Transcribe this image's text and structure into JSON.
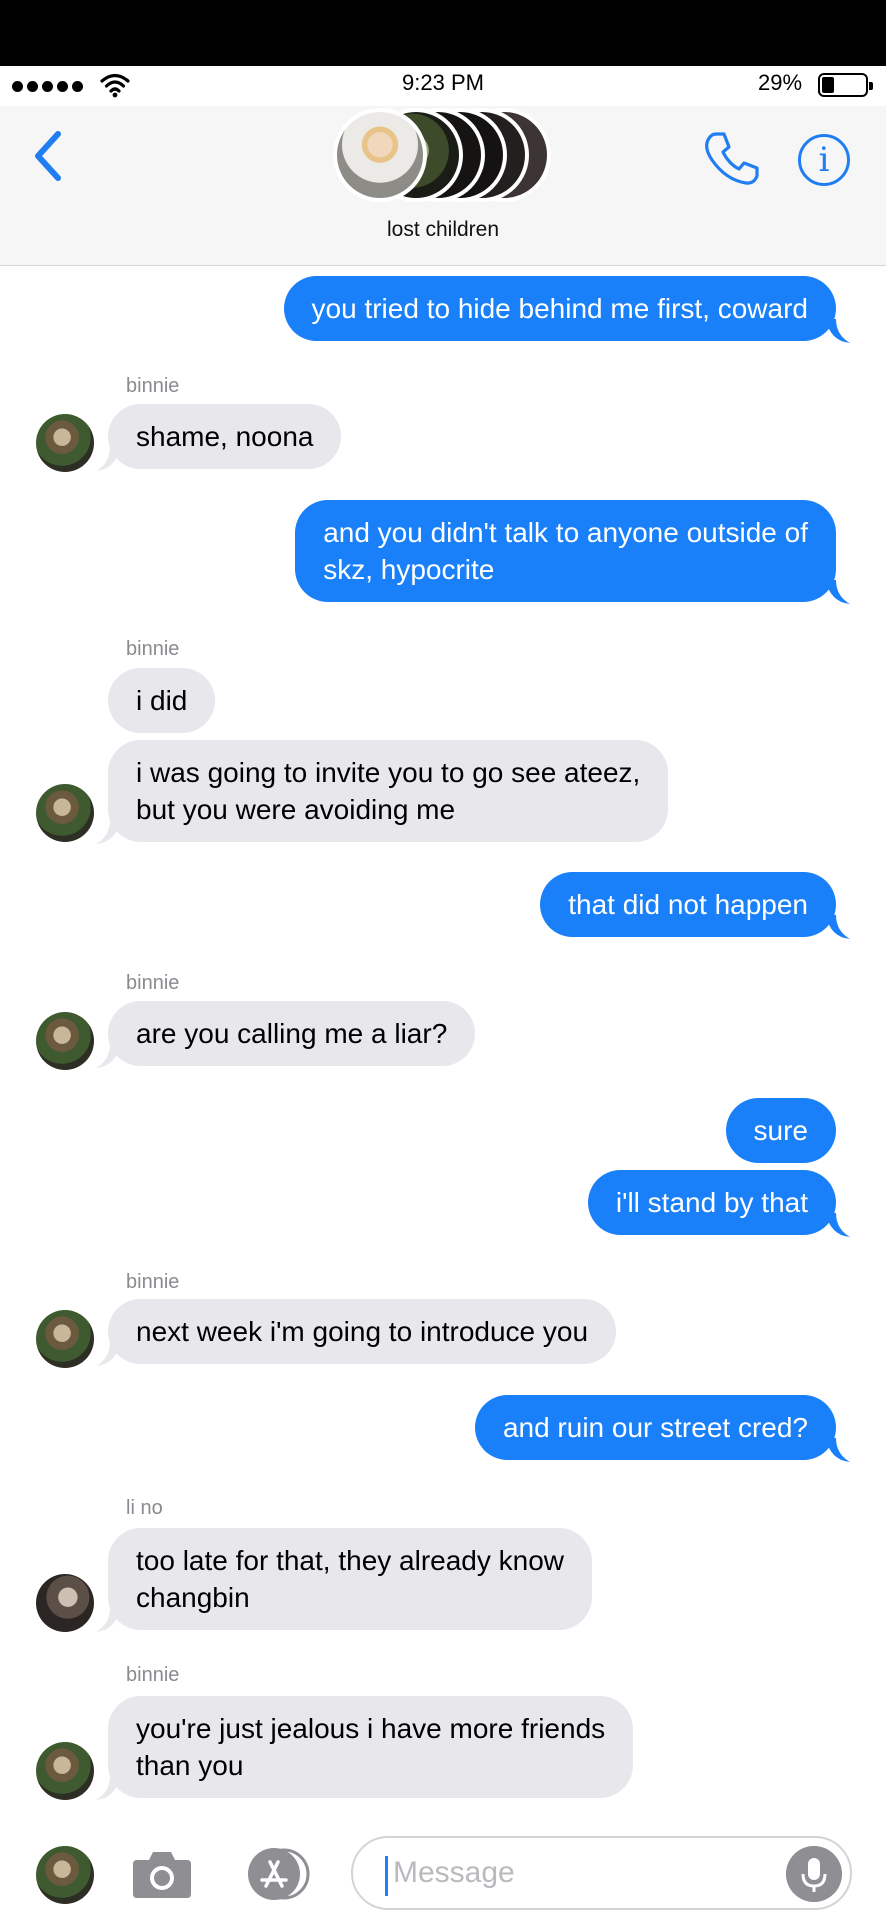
{
  "status": {
    "time": "9:23 PM",
    "battery_pct": "29%",
    "battery_level": 0.29
  },
  "header": {
    "group_name": "lost children",
    "avatar_count": 6
  },
  "messages": [
    {
      "from": "me",
      "lines": [
        "you tried to hide behind me first, coward"
      ]
    },
    {
      "sender": "binnie",
      "lines": [
        "shame, noona"
      ]
    },
    {
      "from": "me",
      "lines": [
        "and you didn't talk to anyone outside of",
        "skz, hypocrite"
      ]
    },
    {
      "sender": "binnie",
      "lines": [
        "i did"
      ]
    },
    {
      "lines": [
        "i was going to invite you to go see ateez,",
        "but you were avoiding me"
      ]
    },
    {
      "from": "me",
      "lines": [
        "that did not happen"
      ]
    },
    {
      "sender": "binnie",
      "lines": [
        "are you calling me a liar?"
      ]
    },
    {
      "from": "me",
      "lines": [
        "sure"
      ]
    },
    {
      "from": "me",
      "lines": [
        "i'll stand by that"
      ]
    },
    {
      "sender": "binnie",
      "lines": [
        "next week i'm going to introduce you"
      ]
    },
    {
      "from": "me",
      "lines": [
        "and ruin our street cred?"
      ]
    },
    {
      "sender": "li no",
      "lines": [
        "too late for that, they already know",
        "changbin"
      ]
    },
    {
      "sender": "binnie",
      "lines": [
        "you're just jealous i have more friends",
        "than you"
      ]
    }
  ],
  "input": {
    "placeholder": "Message"
  },
  "colors": {
    "accent": "#1a80f9",
    "incoming_bubble": "#e7e7ec",
    "outgoing_text": "#ffffff"
  }
}
